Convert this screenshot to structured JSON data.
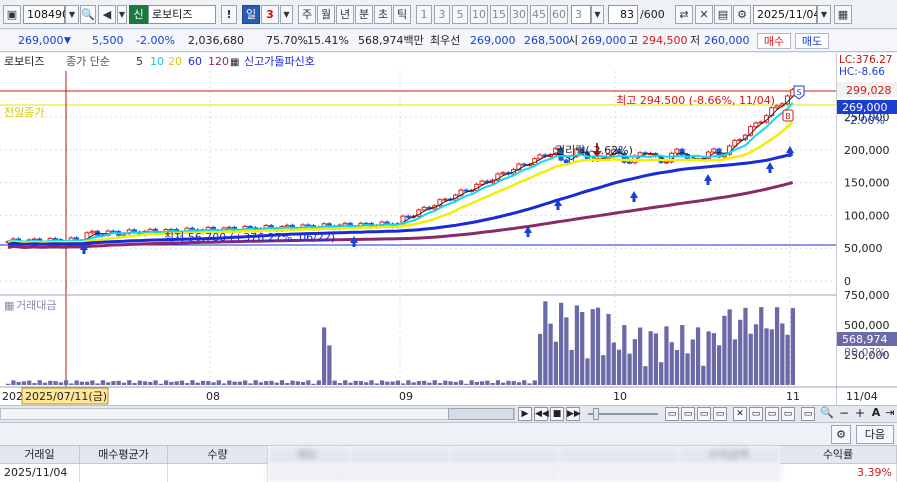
{
  "toolbar": {
    "code": "108490",
    "badge": "신",
    "name": "로보티즈",
    "bang": "!",
    "period_day": "일",
    "period_num": "3",
    "periods": [
      "주",
      "월",
      "년",
      "분",
      "초",
      "틱"
    ],
    "intervals": [
      "1",
      "3",
      "5",
      "10",
      "15",
      "30",
      "45",
      "60"
    ],
    "interval_selected": "3",
    "count": "83",
    "count_total": "/600",
    "date": "2025/11/04"
  },
  "quote": {
    "price": "269,000",
    "change": "5,500",
    "change_pct": "-2.00%",
    "volume": "2,036,680",
    "ratio1": "75.70%",
    "ratio2": "15.41%",
    "amount": "568,974백만",
    "best_label": "최우선",
    "best_ask": "269,000",
    "best_bid": "268,500",
    "open_label": "시",
    "open": "269,000",
    "high_label": "고",
    "high": "294,500",
    "low_label": "저",
    "low": "260,000",
    "buy_btn": "매수",
    "sell_btn": "매도"
  },
  "chart": {
    "stock_label": "로보티즈",
    "ma_label": "종가 단순",
    "ma_periods": [
      "5",
      "10",
      "20",
      "60",
      "120"
    ],
    "signal_label": "신고가돌파신호",
    "prev_close_label": "전일종가",
    "max_label": "최고 294.500 (-8.66%, 11/04)",
    "min_label": "최저 56,700 (+376.27%, 06/22)",
    "rights_label": "권리락(-2.62%)",
    "lc_label": "LC:376.27",
    "hc_label": "HC:-8.66",
    "price_ticks": [
      "250,000",
      "200,000",
      "150,000",
      "100,000",
      "50,000",
      "0"
    ],
    "tag_high": "299,028",
    "tag_current": "269,000",
    "tag_current_pct": "-2.00%",
    "volume_label": "거래대금",
    "vol_ticks": [
      "750,000",
      "500,000",
      "250,000"
    ],
    "vol_tag": "568,974",
    "vol_tag_pct": "80.07%",
    "months": [
      "08",
      "09",
      "10",
      "11"
    ],
    "year_prefix": "202",
    "cursor_date": "2025/07/11(금)",
    "axis_last": "11/04"
  },
  "bottom": {
    "next_btn": "다음",
    "columns": [
      "거래일",
      "매수평균가",
      "수량",
      "매도",
      "",
      "",
      "",
      "수익금액",
      "수익률"
    ],
    "row": {
      "date": "2025/11/04",
      "return_pct": "3.39%"
    }
  }
}
